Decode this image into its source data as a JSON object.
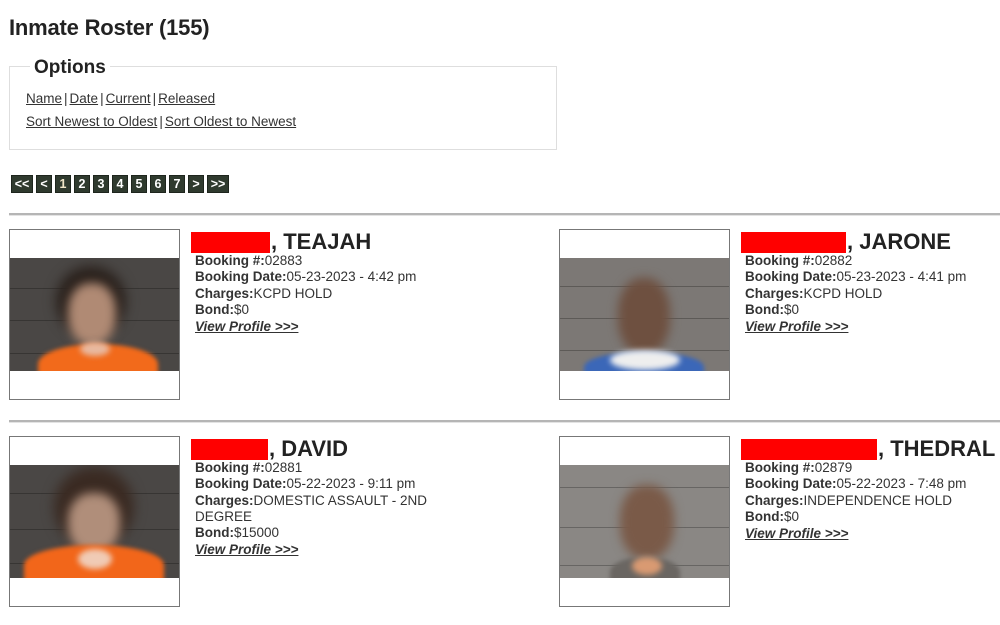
{
  "page": {
    "title": "Inmate Roster (155)"
  },
  "options": {
    "title": "Options",
    "filter_links": [
      "Name",
      "Date",
      "Current",
      "Released"
    ],
    "sort_links": [
      "Sort Newest to Oldest",
      "Sort Oldest to Newest"
    ],
    "separator": "|"
  },
  "pagination": {
    "first": "<<",
    "prev": "<",
    "pages": [
      "1",
      "2",
      "3",
      "4",
      "5",
      "6",
      "7"
    ],
    "current_page": "1",
    "next": ">",
    "last": ">>"
  },
  "labels": {
    "booking_number": "Booking #:",
    "booking_date": "Booking Date:",
    "charges": "Charges:",
    "bond": "Bond:",
    "view_profile": "View Profile >>>"
  },
  "inmates": [
    {
      "last_name_redacted": true,
      "first_name": ", TEAJAH",
      "booking_number": "02883",
      "booking_date": "05-23-2023 - 4:42 pm",
      "charges": "KCPD HOLD",
      "bond": "$0",
      "photo_icon": "mugshot-photo-blurred"
    },
    {
      "last_name_redacted": true,
      "first_name": ", JARONE",
      "booking_number": "02882",
      "booking_date": "05-23-2023 - 4:41 pm",
      "charges": "KCPD HOLD",
      "bond": "$0",
      "photo_icon": "mugshot-photo-blurred"
    },
    {
      "last_name_redacted": true,
      "first_name": ", DAVID",
      "booking_number": "02881",
      "booking_date": "05-22-2023 - 9:11 pm",
      "charges": "DOMESTIC ASSAULT - 2ND DEGREE",
      "bond": "$15000",
      "photo_icon": "mugshot-photo-blurred"
    },
    {
      "last_name_redacted": true,
      "first_name": ", THEDRAL",
      "booking_number": "02879",
      "booking_date": "05-22-2023 - 7:48 pm",
      "charges": "INDEPENDENCE HOLD",
      "bond": "$0",
      "photo_icon": "mugshot-photo-blurred"
    }
  ],
  "colors": {
    "pager_bg": "#2f3a2e",
    "redaction": "#ff0000",
    "text": "#333333"
  }
}
